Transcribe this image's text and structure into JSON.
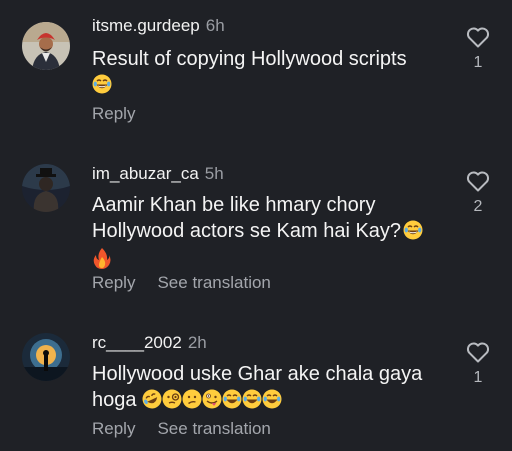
{
  "comments": [
    {
      "username": "itsme.gurdeep",
      "time": "6h",
      "text_lines": [
        "Result of copying Hollywood scripts"
      ],
      "emoji_line": [
        "laugh-tears-emoji"
      ],
      "reply_label": "Reply",
      "translate_label": "",
      "likes": "1"
    },
    {
      "username": "im_abuzar_ca",
      "time": "5h",
      "text_lines": [
        "Aamir Khan be like hmary chory",
        "Hollywood actors se Kam hai Kay?"
      ],
      "emoji_line": [
        "fire-emoji"
      ],
      "reply_label": "Reply",
      "translate_label": "See translation",
      "likes": "2"
    },
    {
      "username": "rc____2002",
      "time": "2h",
      "text_lines": [
        "Hollywood uske Ghar ake chala gaya",
        "hoga"
      ],
      "emoji_line": [
        "rofl-emoji",
        "monocle-emoji",
        "confused-emoji",
        "zany-emoji",
        "laugh-tears-emoji",
        "laugh-tears-emoji",
        "laugh-tears-emoji"
      ],
      "reply_label": "Reply",
      "translate_label": "See translation",
      "likes": "1"
    }
  ],
  "colors": {
    "background": "#1f2126",
    "secondary_text": "#a3a6ac",
    "emoji_yellow": "#ffcc3d"
  }
}
